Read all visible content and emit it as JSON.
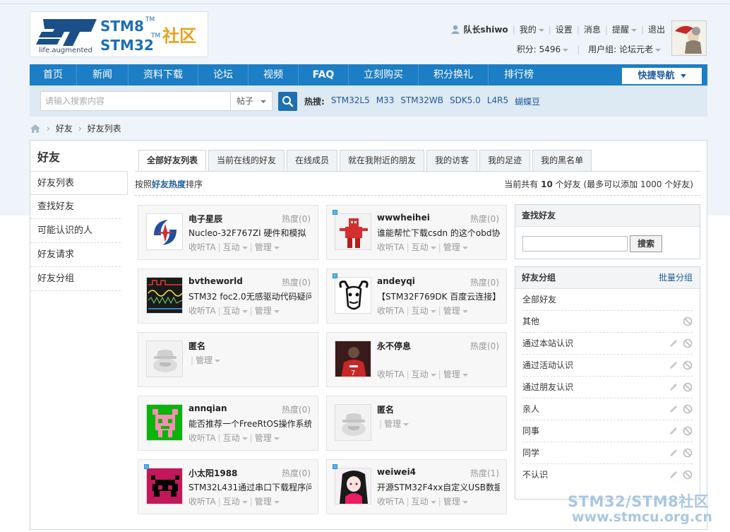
{
  "logo": {
    "tagline": "life.augmented",
    "stm8": "STM8",
    "stm32": "STM32",
    "tm": "TM",
    "community": "社区"
  },
  "user": {
    "name": "队长shiwo",
    "links": [
      "我的",
      "设置",
      "消息",
      "提醒",
      "退出"
    ],
    "points_label": "积分: 5496",
    "group_label": "用户组: 论坛元老"
  },
  "nav": {
    "items": [
      "首页",
      "新闻",
      "资料下载",
      "论坛",
      "视频",
      "FAQ",
      "立刻购买",
      "积分换礼",
      "排行榜"
    ],
    "quick_nav": "快捷导航"
  },
  "search": {
    "placeholder": "请输入搜索内容",
    "type": "帖子",
    "hot_label": "热搜:",
    "hot_terms": [
      "STM32L5",
      "M33",
      "STM32WB",
      "SDK5.0",
      "L4R5",
      "蝴蝶豆"
    ]
  },
  "breadcrumb": [
    "好友",
    "好友列表"
  ],
  "sidebar": {
    "title": "好友",
    "items": [
      "好友列表",
      "查找好友",
      "可能认识的人",
      "好友请求",
      "好友分组"
    ]
  },
  "tabs": [
    "全部好友列表",
    "当前在线的好友",
    "在线成员",
    "就在我附近的朋友",
    "我的访客",
    "我的足迹",
    "我的黑名单"
  ],
  "sort": {
    "prefix": "按照",
    "key": "好友热度",
    "suffix": "排序",
    "total_prefix": "当前共有",
    "total": "10",
    "total_suffix": "个好友 (最多可以添加 1000 个好友)"
  },
  "actions": {
    "follow": "收听TA",
    "interact": "互动",
    "manage": "管理"
  },
  "friends": [
    {
      "name": "电子星辰",
      "heat": "热度(0)",
      "msg": "Nucleo-32F767ZI 硬件和模拟",
      "online": false,
      "avatar": "logo-blue"
    },
    {
      "name": "wwwheihei",
      "heat": "热度(0)",
      "msg": "谁能帮忙下载csdn 的这个obd协",
      "online": true,
      "avatar": "red-robot"
    },
    {
      "name": "bvtheworld",
      "heat": "热度(0)",
      "msg": "STM32 foc2.0无感驱动代码疑问",
      "online": false,
      "avatar": "oscilloscope"
    },
    {
      "name": "andeyqi",
      "heat": "热度(0)",
      "msg": "【STM32F769DK 百度云连接】",
      "online": true,
      "avatar": "gnu"
    },
    {
      "name": "匿名",
      "heat": "",
      "msg": "",
      "online": false,
      "avatar": "anonymous"
    },
    {
      "name": "永不停息",
      "heat": "热度(0)",
      "msg": "",
      "online": false,
      "avatar": "football"
    },
    {
      "name": "annqian",
      "heat": "热度(0)",
      "msg": "能否推荐一个FreeRtOS操作系统",
      "online": false,
      "avatar": "pixel-green"
    },
    {
      "name": "匿名",
      "heat": "",
      "msg": "",
      "online": false,
      "avatar": "anonymous"
    },
    {
      "name": "小太阳1988",
      "heat": "热度(0)",
      "msg": "STM32L431通过串口下载程序问",
      "online": true,
      "avatar": "pixel-magenta"
    },
    {
      "name": "weiwei4",
      "heat": "热度(1)",
      "msg": "开源STM32F4xx自定义USB数据",
      "online": true,
      "avatar": "anime"
    }
  ],
  "find_panel": {
    "title": "查找好友",
    "button": "搜索"
  },
  "group_panel": {
    "title": "好友分组",
    "batch": "批量分组",
    "groups": [
      {
        "name": "全部好友",
        "edit": false,
        "ban": false
      },
      {
        "name": "其他",
        "edit": false,
        "ban": true
      },
      {
        "name": "通过本站认识",
        "edit": true,
        "ban": true
      },
      {
        "name": "通过活动认识",
        "edit": true,
        "ban": true
      },
      {
        "name": "通过朋友认识",
        "edit": true,
        "ban": true
      },
      {
        "name": "亲人",
        "edit": true,
        "ban": true
      },
      {
        "name": "同事",
        "edit": true,
        "ban": true
      },
      {
        "name": "同学",
        "edit": true,
        "ban": true
      },
      {
        "name": "不认识",
        "edit": true,
        "ban": true
      }
    ]
  },
  "watermark": {
    "line1": "STM32/STM8社区",
    "line2": "www.stmcu.org.cn"
  },
  "colors": {
    "nav": "#1c7ec4",
    "link": "#1c5b9c",
    "accent_orange": "#e8a21d"
  }
}
